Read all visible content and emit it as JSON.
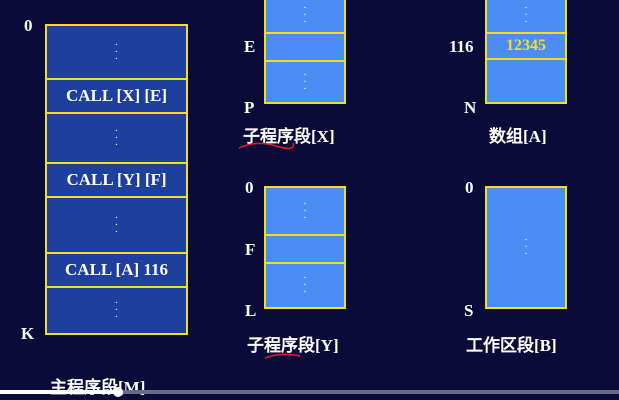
{
  "main_segment": {
    "top_label": "0",
    "bottom_label": "K",
    "cells": [
      {
        "type": "dots"
      },
      {
        "type": "text",
        "text": "CALL [X] [E]"
      },
      {
        "type": "dots"
      },
      {
        "type": "text",
        "text": "CALL [Y] [F]"
      },
      {
        "type": "dots"
      },
      {
        "type": "text",
        "text": "CALL [A] 116"
      },
      {
        "type": "dots"
      }
    ],
    "caption": "主程序段[M]"
  },
  "sub_x": {
    "entry_label": "E",
    "end_label": "P",
    "caption": "子程序段[X]"
  },
  "array_a": {
    "addr_label": "116",
    "end_label": "N",
    "value": "12345",
    "caption": "数组[A]"
  },
  "sub_y": {
    "top_label": "0",
    "entry_label": "F",
    "end_label": "L",
    "caption": "子程序段[Y]"
  },
  "work_b": {
    "top_label": "0",
    "end_label": "S",
    "caption": "工作区段[B]"
  },
  "dots_glyph": "·\n·\n·",
  "player": {
    "progress_fraction": 0.19
  }
}
